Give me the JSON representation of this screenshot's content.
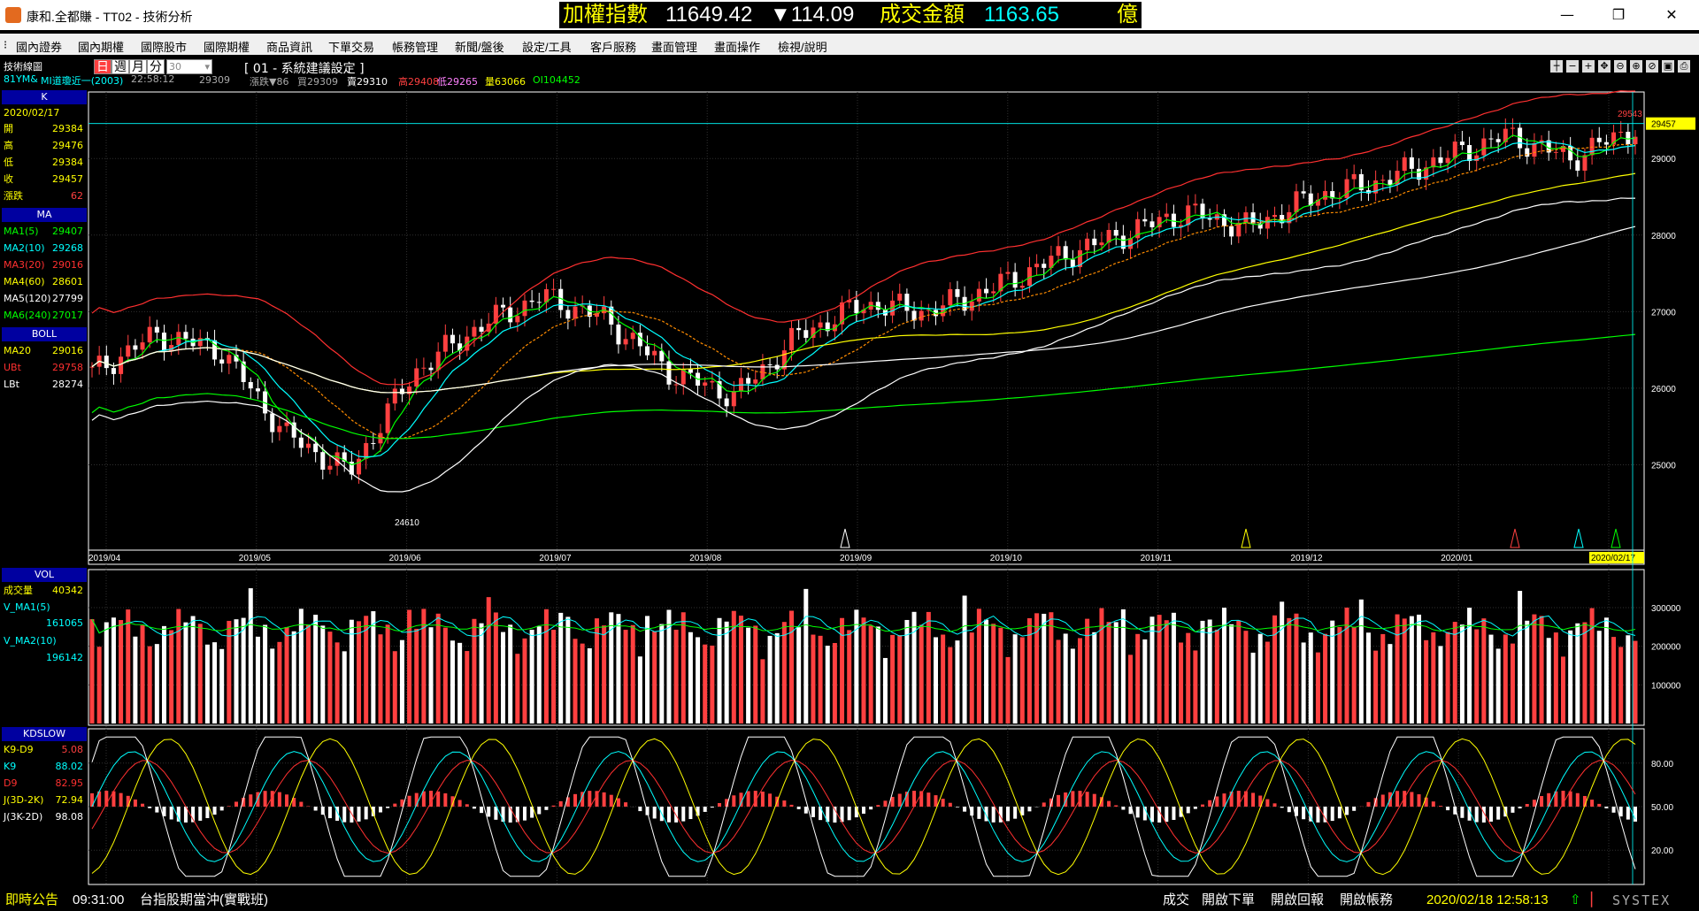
{
  "window": {
    "title": "康和.全都賺 - TT02 - 技術分析",
    "ticker": {
      "label": "加權指數",
      "value": "11649.42",
      "change": "▼114.09",
      "amount_label": "成交金額",
      "amount": "1163.65",
      "unit": "億"
    },
    "controls": {
      "minimize": "—",
      "maximize": "❐",
      "close": "✕"
    }
  },
  "menu": [
    "國內證券",
    "國內期權",
    "國際股市",
    "國際期權",
    "商品資訊",
    "下單交易",
    "帳務管理",
    "新聞/盤後",
    "設定/工具",
    "客戶服務",
    "畫面管理",
    "畫面操作",
    "檢視/說明"
  ],
  "toolbar": {
    "header": "技術線圖",
    "symbol": "81YM&",
    "product": "MI道瓊近一(2003)",
    "time": "22:58:12",
    "periods": [
      "日",
      "週",
      "月",
      "分"
    ],
    "active_period": "日",
    "interval": "30",
    "setting": "[ 01 - 系統建議設定 ]",
    "quote": {
      "price": "29309",
      "change": "漲跌▼86",
      "buy": "買29309",
      "sell": "賣29310",
      "high": "高29408",
      "low": "低29265",
      "volume": "量63066",
      "oi": "OI104452"
    }
  },
  "panels": {
    "k": {
      "title": "K",
      "date": "2020/02/17",
      "rows": [
        {
          "label": "開",
          "value": "29384"
        },
        {
          "label": "高",
          "value": "29476"
        },
        {
          "label": "低",
          "value": "29384"
        },
        {
          "label": "收",
          "value": "29457"
        },
        {
          "label": "漲跌",
          "value": "62"
        }
      ]
    },
    "ma": {
      "title": "MA",
      "rows": [
        {
          "label": "MA1(5)",
          "value": "29407",
          "color": "#00ff00"
        },
        {
          "label": "MA2(10)",
          "value": "29268",
          "color": "#00ffff"
        },
        {
          "label": "MA3(20)",
          "value": "29016",
          "color": "#ff3030"
        },
        {
          "label": "MA4(60)",
          "value": "28601",
          "color": "#ffff00"
        },
        {
          "label": "MA5(120)",
          "value": "27799",
          "color": "#ffffff"
        },
        {
          "label": "MA6(240)",
          "value": "27017",
          "color": "#00ff00"
        }
      ]
    },
    "boll": {
      "title": "BOLL",
      "rows": [
        {
          "label": "MA20",
          "value": "29016",
          "color": "#ffff00"
        },
        {
          "label": "UBt",
          "value": "29758",
          "color": "#ff3030"
        },
        {
          "label": "LBt",
          "value": "28274",
          "color": "#ffffff"
        }
      ]
    },
    "vol": {
      "title": "VOL",
      "rows": [
        {
          "label": "成交量",
          "value": "40342",
          "color": "#ffff00"
        },
        {
          "label": "V_MA1(5)",
          "value": "161065",
          "color": "#00ffff"
        },
        {
          "label": "V_MA2(10)",
          "value": "196142",
          "color": "#00ffff"
        }
      ]
    },
    "kd": {
      "title": "KDSLOW",
      "rows": [
        {
          "label": "K9-D9",
          "value": "5.08",
          "color": "#ffff00"
        },
        {
          "label": "K9",
          "value": "88.02",
          "color": "#00ffff"
        },
        {
          "label": "D9",
          "value": "82.95",
          "color": "#ff3030"
        },
        {
          "label": "J(3D-2K)",
          "value": "72.94",
          "color": "#ffff00"
        },
        {
          "label": "J(3K-2D)",
          "value": "98.08",
          "color": "#ffffff"
        }
      ]
    }
  },
  "chart_data": {
    "type": "candlestick",
    "price_axis": {
      "ticks": [
        "29000",
        "28000",
        "27000",
        "26000",
        "25000"
      ],
      "current": "29457",
      "range": [
        24000,
        29800
      ]
    },
    "x_labels": [
      "2019/04",
      "2019/05",
      "2019/06",
      "2019/07",
      "2019/08",
      "2019/09",
      "2019/10",
      "2019/11",
      "2019/12",
      "2020/01",
      "2020/02"
    ],
    "current_date": "2020/02/17",
    "annotations": {
      "high": "29543",
      "low": "24610"
    },
    "volume_axis": {
      "ticks": [
        "300000",
        "200000",
        "100000"
      ]
    },
    "kd_axis": {
      "ticks": [
        "80.00",
        "50.00",
        "20.00"
      ]
    }
  },
  "statusbar": {
    "left_label": "即時公告",
    "time": "09:31:00",
    "message": "台指股期當沖(實戰班)",
    "buttons": [
      "成交",
      "開啟下單",
      "開啟回報",
      "開啟帳務"
    ],
    "datetime": "2020/02/18 12:58:13",
    "brand": "SYSTEX"
  },
  "colors": {
    "up": "#ff4040",
    "down": "#ffffff",
    "panel_head": "#0000a0",
    "grid": "#303030"
  }
}
